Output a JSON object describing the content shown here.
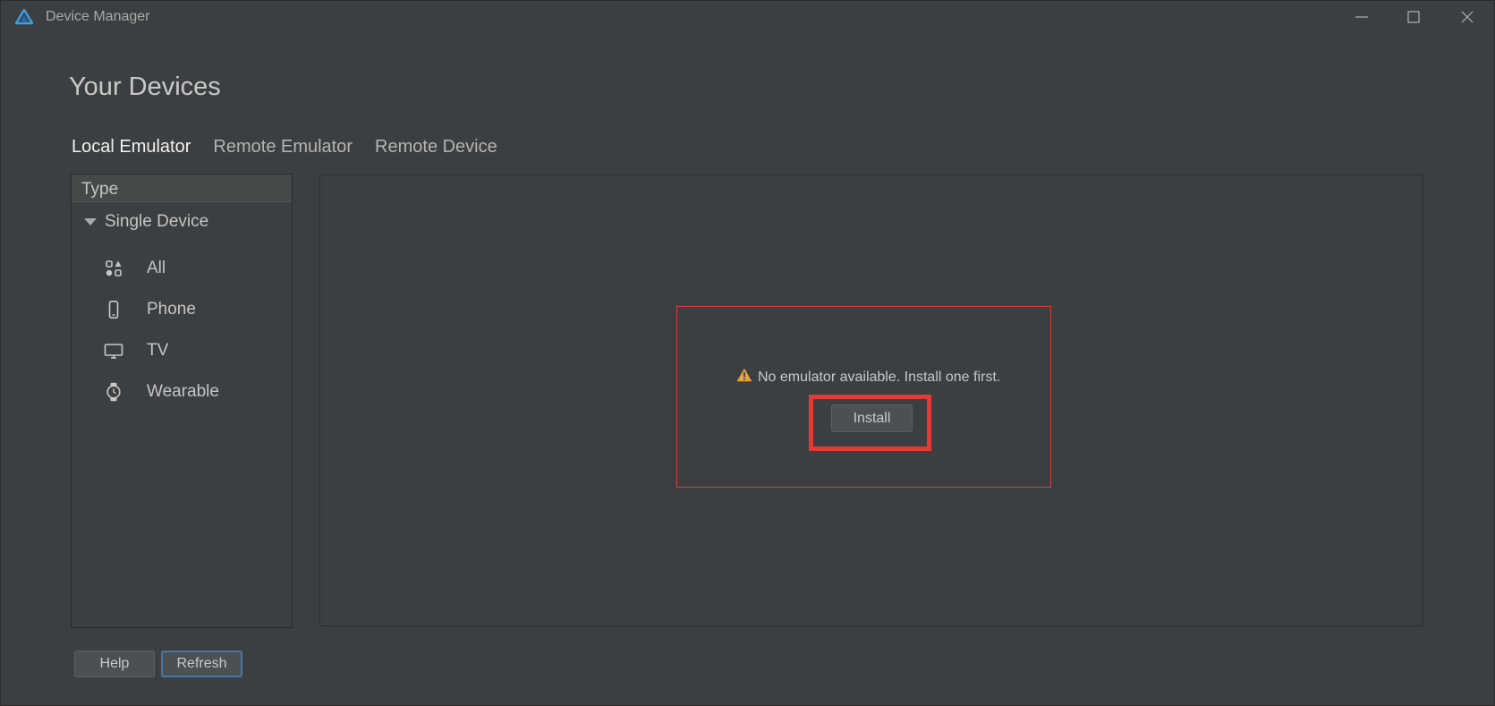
{
  "window": {
    "title": "Device Manager",
    "logo_icon": "deveco-logo-icon",
    "controls": [
      "minimize-icon",
      "maximize-icon",
      "close-icon"
    ]
  },
  "page": {
    "title": "Your Devices"
  },
  "tabs": [
    {
      "label": "Local Emulator",
      "active": true
    },
    {
      "label": "Remote Emulator",
      "active": false
    },
    {
      "label": "Remote Device",
      "active": false
    }
  ],
  "sidebar": {
    "header": "Type",
    "group": {
      "label": "Single Device",
      "expanded": true
    },
    "items": [
      {
        "label": "All",
        "icon": "all-devices-icon"
      },
      {
        "label": "Phone",
        "icon": "phone-icon"
      },
      {
        "label": "TV",
        "icon": "tv-icon"
      },
      {
        "label": "Wearable",
        "icon": "watch-icon"
      }
    ]
  },
  "main": {
    "message": "No emulator available. Install one first.",
    "warning_icon": "warning-icon",
    "install_label": "Install"
  },
  "footer": {
    "help_label": "Help",
    "refresh_label": "Refresh"
  },
  "colors": {
    "background": "#3c3f41",
    "highlight": "#e53935",
    "warning": "#e8a33d",
    "focus": "#4a76a8"
  }
}
